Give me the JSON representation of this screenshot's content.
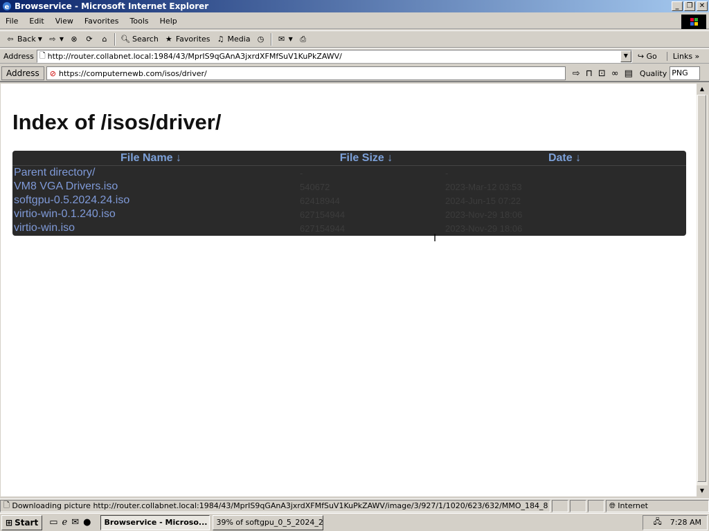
{
  "window": {
    "title": "Browservice - Microsoft Internet Explorer"
  },
  "menu": [
    "File",
    "Edit",
    "View",
    "Favorites",
    "Tools",
    "Help"
  ],
  "toolbar": {
    "back": "Back",
    "search": "Search",
    "favorites": "Favorites",
    "media": "Media"
  },
  "ie_address": {
    "label": "Address",
    "url": "http://router.collabnet.local:1984/43/MprIS9qGAnA3jxrdXFMfSuV1KuPkZAWV/",
    "go": "Go",
    "links": "Links"
  },
  "bs_address": {
    "label": "Address",
    "url": "https://computernewb.com/isos/driver/",
    "quality_label": "Quality",
    "quality_value": "PNG"
  },
  "page": {
    "heading": "Index of /isos/driver/",
    "columns": [
      "File Name  ↓",
      "File Size  ↓",
      "Date  ↓"
    ],
    "rows": [
      {
        "name": "Parent directory/",
        "size": "-",
        "date": "-"
      },
      {
        "name": "VM8 VGA Drivers.iso",
        "size": "540672",
        "date": "2023-Mar-12 03:53"
      },
      {
        "name": "softgpu-0.5.2024.24.iso",
        "size": "62418944",
        "date": "2024-Jun-15 07:22"
      },
      {
        "name": "virtio-win-0.1.240.iso",
        "size": "627154944",
        "date": "2023-Nov-29 18:06"
      },
      {
        "name": "virtio-win.iso",
        "size": "627154944",
        "date": "2023-Nov-29 18:06"
      }
    ]
  },
  "status": {
    "message": "Downloading picture http://router.collabnet.local:1984/43/MprIS9qGAnA3jxrdXFMfSuV1KuPkZAWV/image/3/927/1/1020/623/632/MMO_184_8",
    "zone": "Internet"
  },
  "taskbar": {
    "start": "Start",
    "tasks": [
      "Browservice - Microso...",
      "39% of softgpu_0_5_2024_2..."
    ],
    "clock": "7:28 AM"
  }
}
